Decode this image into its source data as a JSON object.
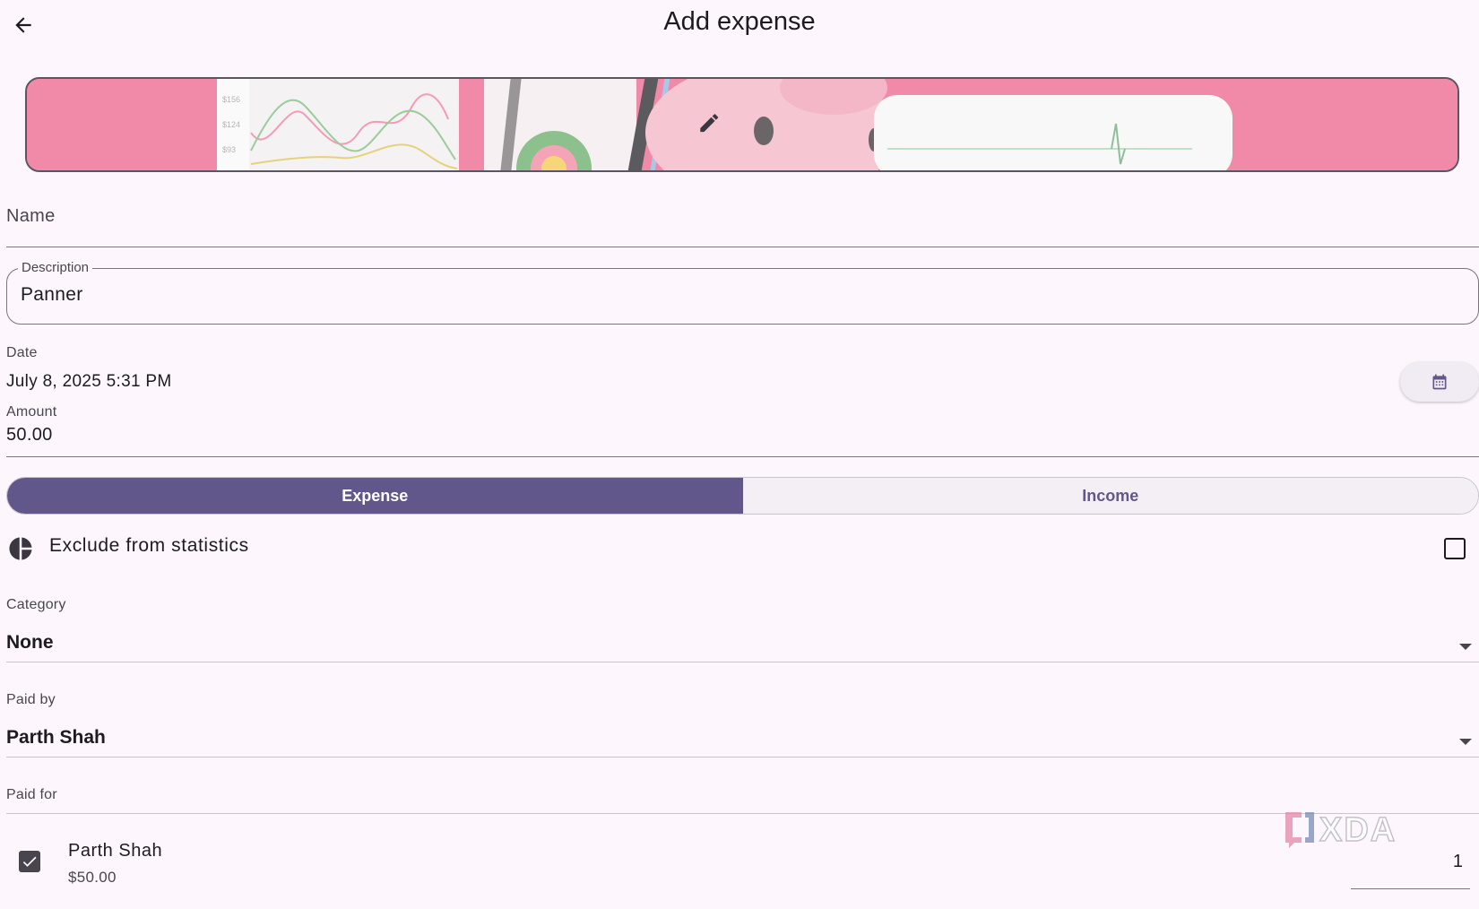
{
  "header": {
    "title": "Add expense"
  },
  "form": {
    "name_placeholder": "Name",
    "description_label": "Description",
    "description_value": "Panner",
    "date_label": "Date",
    "date_value": "July 8, 2025 5:31 PM",
    "amount_label": "Amount",
    "amount_value": "50.00",
    "type_options": [
      "Expense",
      "Income"
    ],
    "type_selected": "Expense",
    "exclude_label": "Exclude from statistics",
    "exclude_checked": false,
    "category_label": "Category",
    "category_value": "None",
    "paid_by_label": "Paid by",
    "paid_by_value": "Parth Shah",
    "paid_for_label": "Paid for",
    "paid_for": [
      {
        "name": "Parth Shah",
        "amount": "$50.00",
        "checked": true,
        "shares": "1"
      }
    ]
  },
  "banner": {
    "tick_labels": [
      "$156",
      "$124",
      "$93"
    ]
  },
  "watermark": "XDA",
  "colors": {
    "background": "#fdf7fd",
    "accent": "#62578b",
    "banner_pink": "#f08aa8",
    "text": "#1d1b20"
  },
  "icons": {
    "back": "arrow-left-icon",
    "banner_edit": "pencil-icon",
    "calendar": "calendar-icon",
    "exclude": "pie-chart-icon",
    "dropdown": "caret-down-icon",
    "check": "check-icon"
  }
}
